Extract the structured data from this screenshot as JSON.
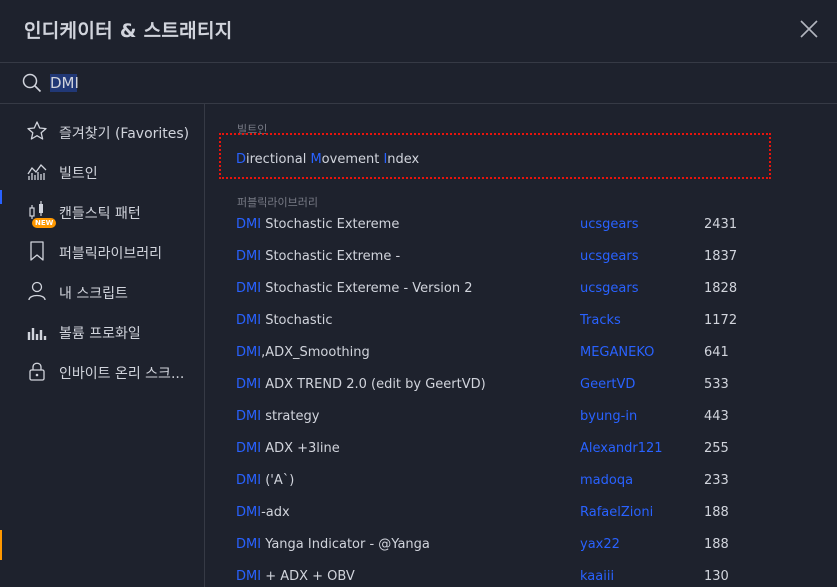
{
  "dialog": {
    "title": "인디케이터 & 스트래티지",
    "close_icon": "close-icon"
  },
  "search": {
    "value": "DMI",
    "placeholder": "",
    "icon": "search-icon"
  },
  "sidebar": {
    "items": [
      {
        "label": "즐겨찾기 (Favorites)",
        "icon": "star-icon"
      },
      {
        "label": "빌트인",
        "icon": "chart-bars-icon"
      },
      {
        "label": "캔들스틱 패턴",
        "icon": "candlestick-icon",
        "badge": "NEW"
      },
      {
        "label": "퍼블릭라이브러리",
        "icon": "bookmark-icon"
      },
      {
        "label": "내 스크립트",
        "icon": "user-icon"
      },
      {
        "label": "볼륨 프로화일",
        "icon": "volume-profile-icon"
      },
      {
        "label": "인바이트 온리 스크...",
        "icon": "lock-icon"
      }
    ]
  },
  "main": {
    "builtin_label": "빌트인",
    "builtin_item": {
      "parts": [
        {
          "text": "D",
          "hl": true
        },
        {
          "text": "irectional ",
          "hl": false
        },
        {
          "text": "M",
          "hl": true
        },
        {
          "text": "ovement ",
          "hl": false
        },
        {
          "text": "I",
          "hl": true
        },
        {
          "text": "ndex",
          "hl": false
        }
      ]
    },
    "public_label": "퍼블릭라이브러리",
    "scripts": [
      {
        "kw": "DMI",
        "rest": " Stochastic Extereme",
        "author": "ucsgears",
        "count": "2431"
      },
      {
        "kw": "DMI",
        "rest": " Stochastic Extreme -",
        "author": "ucsgears",
        "count": "1837"
      },
      {
        "kw": "DMI",
        "rest": " Stochastic Extereme - Version 2",
        "author": "ucsgears",
        "count": "1828"
      },
      {
        "kw": "DMI",
        "rest": " Stochastic",
        "author": "Tracks",
        "count": "1172"
      },
      {
        "kw": "DMI",
        "rest": ",ADX_Smoothing",
        "author": "MEGANEKO",
        "count": "641"
      },
      {
        "kw": "DMI",
        "rest": " ADX TREND 2.0 (edit by GeertVD)",
        "author": "GeertVD",
        "count": "533"
      },
      {
        "kw": "DMI",
        "rest": " strategy",
        "author": "byung-in",
        "count": "443"
      },
      {
        "kw": "DMI",
        "rest": " ADX +3line",
        "author": "Alexandr121",
        "count": "255"
      },
      {
        "kw": "DMI",
        "rest": " ('A`)",
        "author": "madoqa",
        "count": "233"
      },
      {
        "kw": "DMI",
        "rest": "-adx",
        "author": "RafaelZioni",
        "count": "188"
      },
      {
        "kw": "DMI",
        "rest": " Yanga Indicator - @Yanga",
        "author": "yax22",
        "count": "188"
      },
      {
        "kw": "DMI",
        "rest": " + ADX + OBV",
        "author": "kaaiii",
        "count": "130"
      }
    ]
  },
  "colors": {
    "accent": "#2962ff",
    "background": "#1e222d",
    "border": "#363a45",
    "text": "#d1d4dc",
    "muted": "#787b86",
    "highlight_box": "#e8140c",
    "badge": "#ff9800"
  }
}
